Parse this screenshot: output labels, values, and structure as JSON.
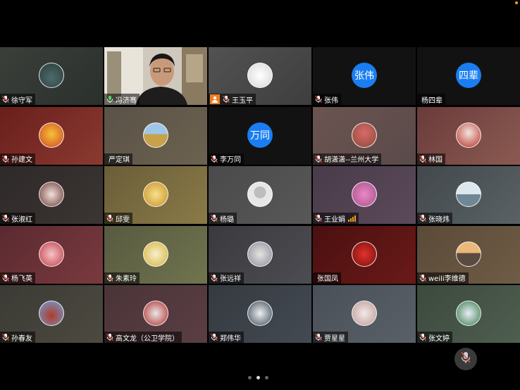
{
  "participants": [
    {
      "name": "徐守军",
      "mic": "muted",
      "bg": "linear-gradient(135deg,#3b3f3a,#2a302d)",
      "avatar": "radial-gradient(circle at 50% 60%,#4d6b6a,#2a3b3c)"
    },
    {
      "name": "冯济骞",
      "mic": "active",
      "video": true
    },
    {
      "name": "王玉平",
      "mic": "muted",
      "self": true,
      "bg": "linear-gradient(135deg,#525252,#3e3e3e)",
      "avatar": "radial-gradient(circle,#ffffff,#d6d6d6)"
    },
    {
      "name": "张伟",
      "mic": "muted",
      "bg": "#121212",
      "initials": "张伟"
    },
    {
      "name": "杨四辈",
      "mic": "none",
      "bg": "#121212",
      "initials": "四辈"
    },
    {
      "name": "孙建文",
      "mic": "muted",
      "bg": "linear-gradient(135deg,#6a1f1c,#8a3a30)",
      "avatar": "radial-gradient(circle at 50% 45%,#f5c233,#d0452a)"
    },
    {
      "name": "严定琪",
      "mic": "none",
      "bg": "linear-gradient(135deg,#5a5248,#6c624f)",
      "avatar": "linear-gradient(180deg,#9fc6e8 45%,#c8a24a 45%)"
    },
    {
      "name": "李万同",
      "mic": "muted",
      "bg": "#121212",
      "initials": "万同"
    },
    {
      "name": "胡潇潇--兰州大学",
      "mic": "muted",
      "bg": "linear-gradient(135deg,#6b5450,#5a4a4a)",
      "avatar": "radial-gradient(circle at 50% 40%,#d86a6a,#8c4a3a)"
    },
    {
      "name": "林国",
      "mic": "muted",
      "bg": "linear-gradient(135deg,#6b3b3b,#8a5a52)",
      "avatar": "radial-gradient(circle at 50% 40%,#f2e6e0,#b8302a)"
    },
    {
      "name": "张淑红",
      "mic": "muted",
      "bg": "linear-gradient(135deg,#2e2a29,#3b3533)",
      "avatar": "radial-gradient(circle,#f1e2dc,#6b3a37)"
    },
    {
      "name": "邱雯",
      "mic": "muted",
      "bg": "linear-gradient(135deg,#6a5e39,#8a7a48)",
      "avatar": "radial-gradient(circle,#f7e08a,#c7902a)"
    },
    {
      "name": "杨璐",
      "mic": "muted",
      "bg": "linear-gradient(135deg,#4a4a4a,#585858)",
      "avatar": "radial-gradient(circle at 50% 42%,#bdbdbd 32%,#e6e6e6 33%)"
    },
    {
      "name": "王业娟",
      "mic": "muted",
      "signal": true,
      "bg": "linear-gradient(135deg,#4a3b4a,#5a4a5a)",
      "avatar": "radial-gradient(circle,#e889c7,#a8508a)"
    },
    {
      "name": "张晓炜",
      "mic": "muted",
      "bg": "linear-gradient(135deg,#42484c,#5a6266)",
      "avatar": "linear-gradient(180deg,#dde7ee 50%,#6f8895 50%)"
    },
    {
      "name": "杨飞英",
      "mic": "muted",
      "bg": "linear-gradient(135deg,#5a2a30,#7a3a3e)",
      "avatar": "radial-gradient(circle,#f3c6c6,#c23b4a)"
    },
    {
      "name": "朱素玲",
      "mic": "muted",
      "bg": "linear-gradient(135deg,#585a40,#70744e)",
      "avatar": "radial-gradient(circle,#f6f0ce,#d6b23a)"
    },
    {
      "name": "张远祥",
      "mic": "muted",
      "bg": "linear-gradient(135deg,#3a3a3e,#4c4c52)",
      "avatar": "radial-gradient(circle,#e6e3e0,#8a8f9a)"
    },
    {
      "name": "张国凤",
      "mic": "none",
      "bg": "linear-gradient(135deg,#4a1010,#6a1a18)",
      "avatar": "radial-gradient(circle,#e0332a,#7a0f0e)"
    },
    {
      "name": "weili李维德",
      "mic": "muted",
      "bg": "linear-gradient(135deg,#5a4a38,#6f5c46)",
      "avatar": "linear-gradient(180deg,#e9b87a 45%,#5a4a40 45%)"
    },
    {
      "name": "孙春友",
      "mic": "muted",
      "bg": "linear-gradient(135deg,#3b3a34,#4c4a40)",
      "avatar": "radial-gradient(circle at 50% 60%,#b23b2a,#6aa0d8)"
    },
    {
      "name": "高文龙（公卫学院）",
      "mic": "muted",
      "bg": "linear-gradient(135deg,#4a3438,#5a3e44)",
      "avatar": "radial-gradient(circle,#e8e8e8,#b22a2a)"
    },
    {
      "name": "郑伟华",
      "mic": "muted",
      "bg": "linear-gradient(135deg,#353a40,#444a52)",
      "avatar": "radial-gradient(circle,#f0f0f0,#3a4a5a)"
    },
    {
      "name": "贾星星",
      "mic": "muted",
      "bg": "linear-gradient(135deg,#4a5058,#5a6068)",
      "avatar": "radial-gradient(circle,#f6e8e6,#b89a96)"
    },
    {
      "name": "张文婷",
      "mic": "muted",
      "bg": "linear-gradient(135deg,#3c4a3e,#4e5e50)",
      "avatar": "radial-gradient(circle,#e8eef8,#3a7a4a)"
    }
  ],
  "colors": {
    "accent": "#1a7ef2",
    "self_badge": "#ee7d22",
    "speaking": "#4cd964",
    "muted": "#e04a3a"
  },
  "controls": {
    "mute_icon": "mic-muted-icon",
    "page_count": 3,
    "current_page": 2
  }
}
